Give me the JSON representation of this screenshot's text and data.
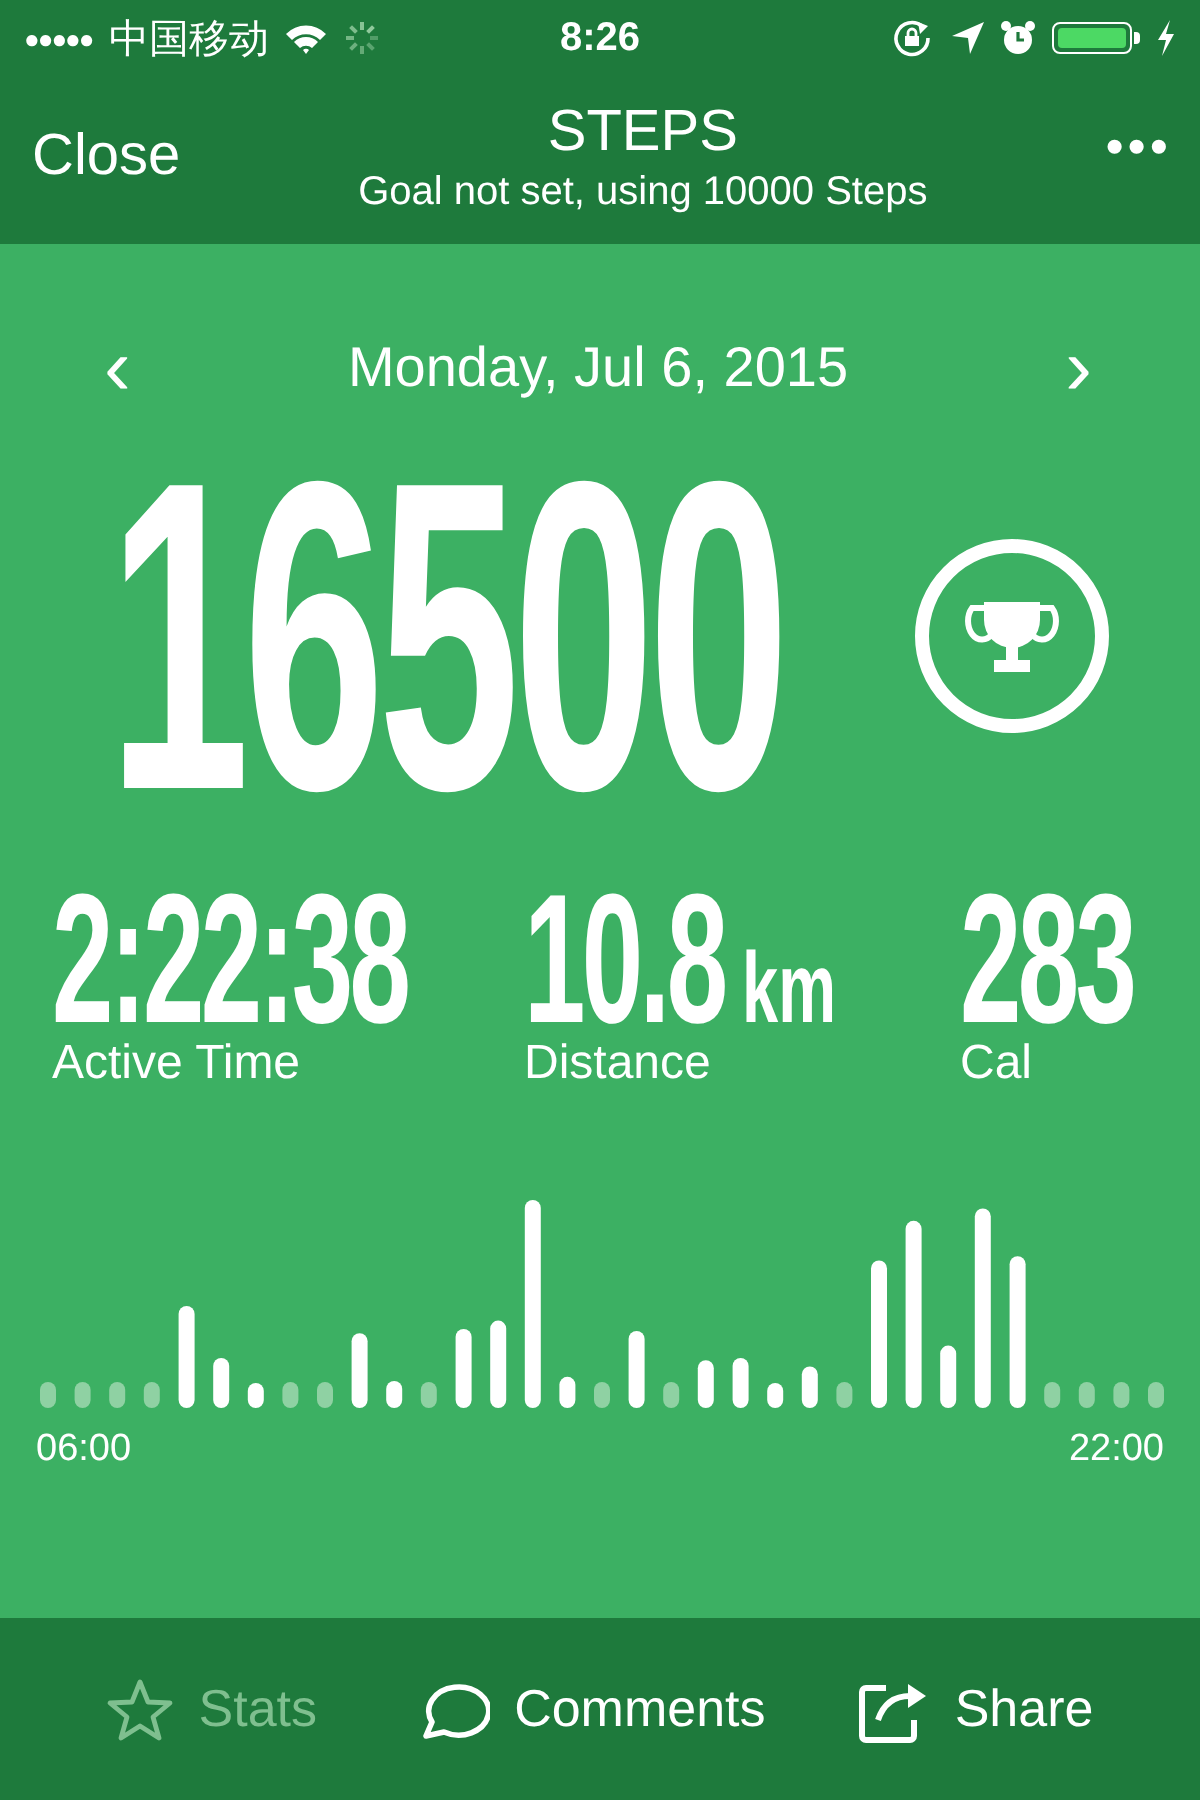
{
  "status_bar": {
    "signal_dots": "●●●●●",
    "carrier": "中国移动",
    "time": "8:26",
    "battery": {
      "level": 1.0
    }
  },
  "nav": {
    "close": "Close",
    "title": "STEPS",
    "subtitle": "Goal not set, using 10000 Steps",
    "more": "•••"
  },
  "date_nav": {
    "prev": "‹",
    "date": "Monday, Jul 6, 2015",
    "next": "›"
  },
  "steps": "16500",
  "metrics": [
    {
      "value": "2:22:38",
      "label": "Active Time"
    },
    {
      "value": "10.8",
      "unit": "km",
      "label": "Distance"
    },
    {
      "value": "283",
      "label": "Cal"
    }
  ],
  "axis": {
    "start": "06:00",
    "end": "22:00"
  },
  "toolbar": [
    {
      "kind": "stats",
      "label": "Stats",
      "disabled": true
    },
    {
      "kind": "comments",
      "label": "Comments",
      "disabled": false
    },
    {
      "kind": "share",
      "label": "Share",
      "disabled": false
    }
  ]
}
